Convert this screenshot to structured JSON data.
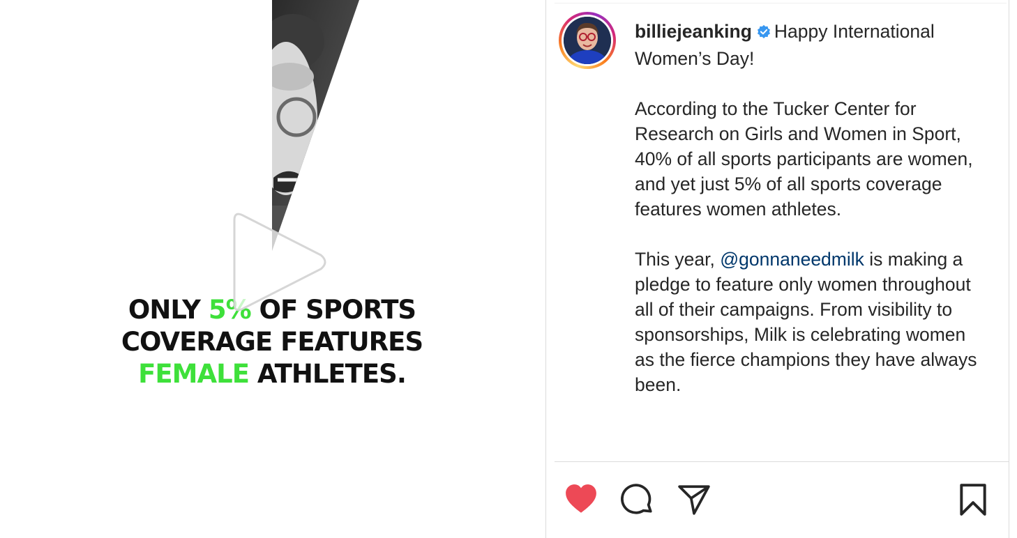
{
  "post": {
    "media": {
      "headline_part1": "ONLY ",
      "headline_highlight1": "5%",
      "headline_part2": " OF SPORTS COVERAGE FEATURES ",
      "headline_highlight2": "FEMALE",
      "headline_part3": " ATHLETES.",
      "highlight_color": "#3ee03a",
      "play_icon": "play-icon"
    },
    "author": {
      "username": "billiejeanking",
      "verified_icon": "verified-badge-icon"
    },
    "caption": {
      "line1": "Happy International Women’s Day!",
      "para2": "According to the Tucker Center for Research on Girls and Women in Sport, 40% of all sports participants are women, and yet just 5% of all sports coverage features women athletes.",
      "para3_start": "This year, ",
      "mention": "@gonnaneedmilk",
      "para3_end": " is making a pledge to feature only women throughout all of their campaigns. From visibility to sponsorships, Milk is celebrating women as the fierce champions they have always been."
    },
    "actions": {
      "like_icon": "heart-icon",
      "liked": true,
      "like_color": "#ed4956",
      "comment_icon": "comment-icon",
      "share_icon": "send-icon",
      "save_icon": "bookmark-icon"
    }
  }
}
